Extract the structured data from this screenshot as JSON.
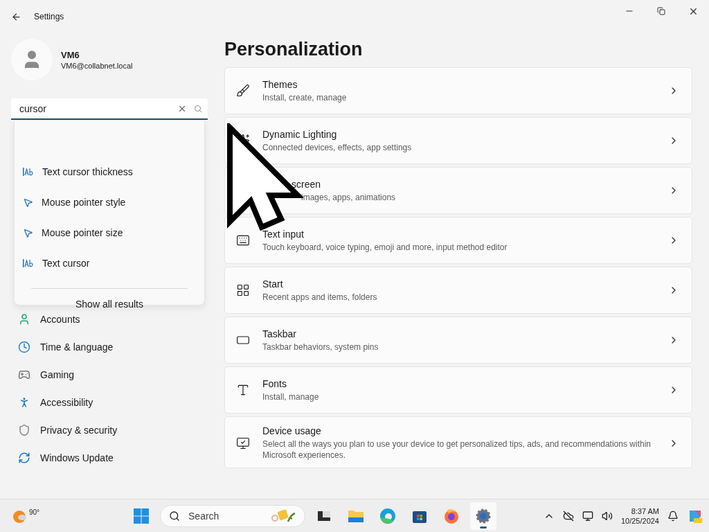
{
  "window": {
    "title": "Settings"
  },
  "profile": {
    "name": "VM6",
    "email": "VM6@collabnet.local"
  },
  "search": {
    "value": "cursor",
    "results": [
      {
        "label": "Text cursor thickness",
        "kind": "text"
      },
      {
        "label": "Mouse pointer style",
        "kind": "pointer"
      },
      {
        "label": "Mouse pointer size",
        "kind": "pointer"
      },
      {
        "label": "Text cursor",
        "kind": "text"
      }
    ],
    "show_all": "Show all results"
  },
  "sidebar": {
    "items": [
      {
        "label": "Accounts",
        "kind": "accounts"
      },
      {
        "label": "Time & language",
        "kind": "time"
      },
      {
        "label": "Gaming",
        "kind": "gaming"
      },
      {
        "label": "Accessibility",
        "kind": "accessibility"
      },
      {
        "label": "Privacy & security",
        "kind": "privacy"
      },
      {
        "label": "Windows Update",
        "kind": "update"
      }
    ]
  },
  "page": {
    "title": "Personalization",
    "cards": [
      {
        "kind": "themes",
        "title": "Themes",
        "subtitle": "Install, create, manage",
        "covered": false
      },
      {
        "kind": "lighting",
        "title": "Dynamic Lighting",
        "subtitle": "Connected devices, effects, app settings",
        "covered": false
      },
      {
        "kind": "lock",
        "title": "screen",
        "subtitle": "images, apps, animations",
        "covered": true
      },
      {
        "kind": "textinput",
        "title": "Text input",
        "subtitle": "Touch keyboard, voice typing, emoji and more, input method editor",
        "covered": false
      },
      {
        "kind": "start",
        "title": "Start",
        "subtitle": "Recent apps and items, folders",
        "covered": false
      },
      {
        "kind": "taskbar",
        "title": "Taskbar",
        "subtitle": "Taskbar behaviors, system pins",
        "covered": false
      },
      {
        "kind": "fonts",
        "title": "Fonts",
        "subtitle": "Install, manage",
        "covered": false
      },
      {
        "kind": "usage",
        "title": "Device usage",
        "subtitle": "Select all the ways you plan to use your device to get personalized tips, ads, and recommendations within Microsoft experiences.",
        "covered": false
      }
    ]
  },
  "taskbar": {
    "weather": "90°",
    "search_placeholder": "Search",
    "apps": [
      {
        "kind": "taskview",
        "selected": false
      },
      {
        "kind": "explorer",
        "selected": false
      },
      {
        "kind": "edge",
        "selected": false
      },
      {
        "kind": "store",
        "selected": false
      },
      {
        "kind": "firefox",
        "selected": false
      },
      {
        "kind": "settings",
        "selected": true
      }
    ],
    "time": "8:37 AM",
    "date": "10/25/2024"
  }
}
